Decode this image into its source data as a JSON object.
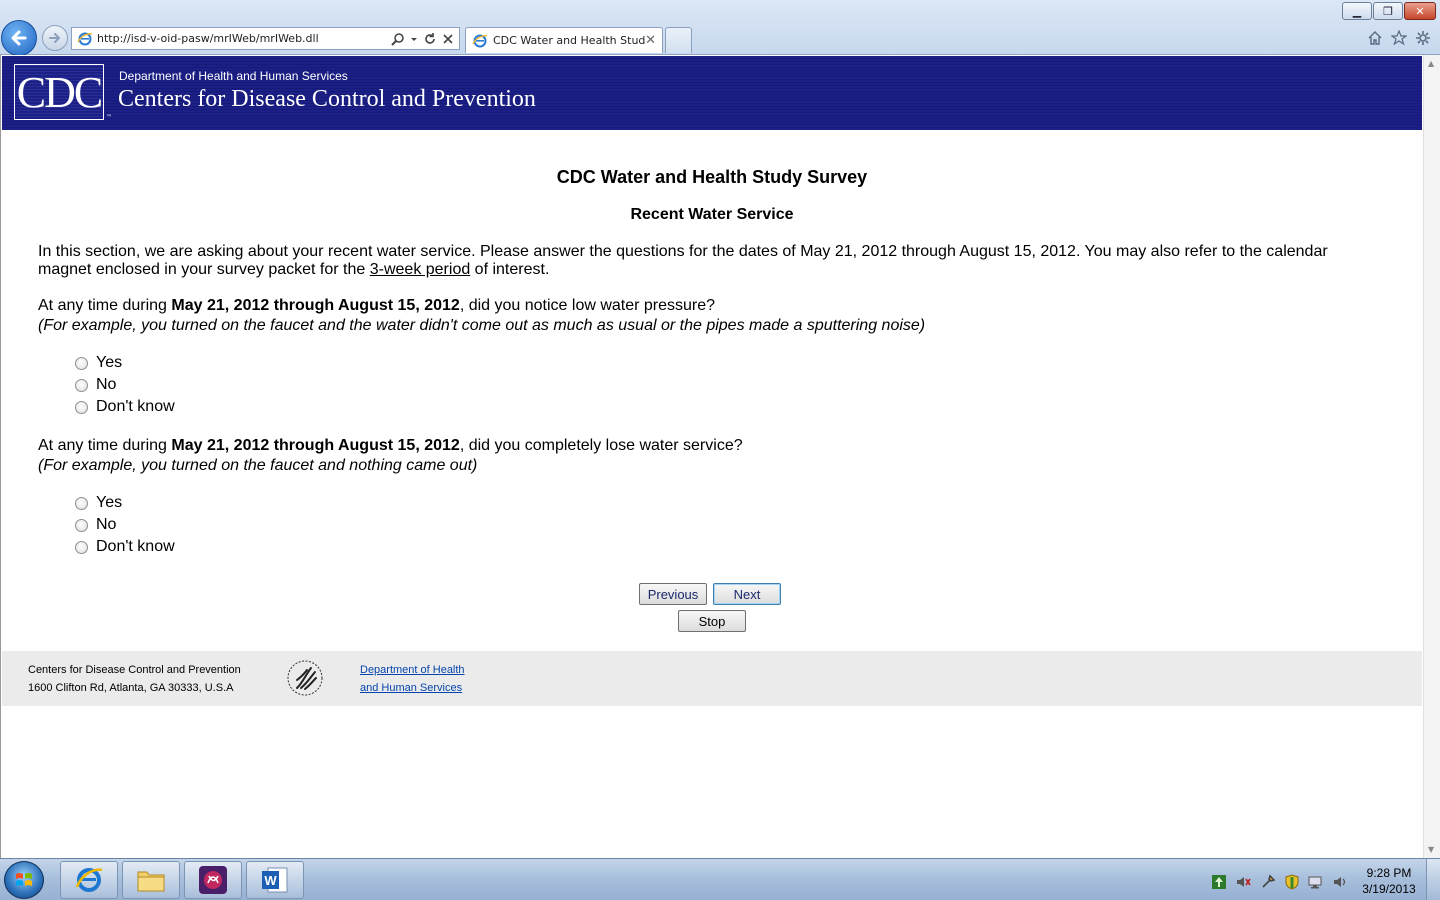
{
  "browser": {
    "url": "http://isd-v-oid-pasw/mrIWeb/mrIWeb.dll",
    "tab_title": "CDC Water and Health Study",
    "tab_close": "✕",
    "window_buttons": {
      "minimize": "▁",
      "restore": "❐",
      "close": "✕"
    }
  },
  "banner": {
    "logo": "CDC",
    "dept": "Department of Health and Human Services",
    "name": "Centers for Disease Control and Prevention"
  },
  "survey": {
    "title": "CDC Water and Health Study Survey",
    "section": "Recent Water Service",
    "intro_before": "In this section, we are asking about your recent water service. Please answer the questions for the dates of May 21, 2012 through August 15, 2012. You may also refer to the calendar magnet enclosed in your survey packet for the ",
    "intro_link": "3-week period",
    "intro_after": " of interest.",
    "questions": [
      {
        "prefix": "At any time during ",
        "dates": "May 21, 2012 through August 15, 2012",
        "suffix": ", did you notice low water pressure?",
        "note": "(For example, you turned on the faucet and the water didn't come out as much as usual or the pipes made a sputtering noise)",
        "options": [
          "Yes",
          "No",
          "Don't know"
        ]
      },
      {
        "prefix": "At any time during ",
        "dates": "May 21, 2012 through August 15, 2012",
        "suffix": ", did you completely lose water service?",
        "note": "(For example, you turned on the faucet and nothing came out)",
        "options": [
          "Yes",
          "No",
          "Don't know"
        ]
      }
    ],
    "buttons": {
      "previous": "Previous",
      "next": "Next",
      "stop": "Stop"
    }
  },
  "footer": {
    "org": "Centers for Disease Control and Prevention",
    "address": "1600 Clifton Rd, Atlanta, GA 30333, U.S.A",
    "link_line1": "Department of Health",
    "link_line2": "and Human Services"
  },
  "taskbar": {
    "time": "9:28 PM",
    "date": "3/19/2013"
  },
  "colors": {
    "banner": "#1b1f86",
    "link": "#0645ad",
    "footer_bg": "#ebebeb"
  }
}
